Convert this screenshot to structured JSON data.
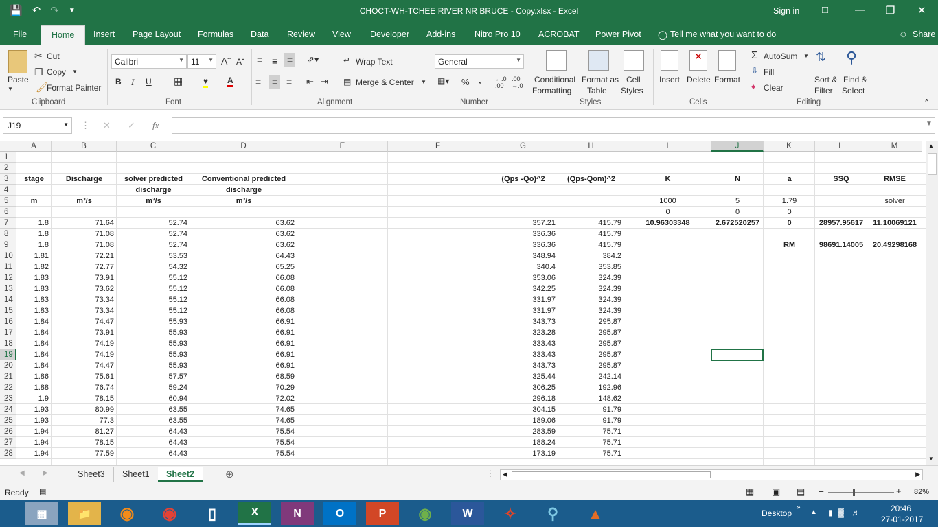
{
  "title": "CHOCT-WH-TCHEE RIVER NR BRUCE - Copy.xlsx  -  Excel",
  "signin": "Sign in",
  "tabs": [
    "File",
    "Home",
    "Insert",
    "Page Layout",
    "Formulas",
    "Data",
    "Review",
    "View",
    "Developer",
    "Add-ins",
    "Nitro Pro 10",
    "ACROBAT",
    "Power Pivot"
  ],
  "tell_me": "Tell me what you want to do",
  "share": "Share",
  "ribbon": {
    "paste": "Paste",
    "cut": "Cut",
    "copy": "Copy",
    "format_painter": "Format Painter",
    "clipboard": "Clipboard",
    "font_name": "Calibri",
    "font_size": "11",
    "font_group": "Font",
    "wrap_text": "Wrap Text",
    "merge_center": "Merge & Center",
    "alignment": "Alignment",
    "number_format": "General",
    "number": "Number",
    "percent": "%",
    "comma": ",",
    "conditional": "Conditional",
    "formatting": "Formatting",
    "format_as": "Format as",
    "table": "Table",
    "cell": "Cell",
    "cell_styles": "Styles",
    "styles": "Styles",
    "insert": "Insert",
    "delete": "Delete",
    "format": "Format",
    "cells": "Cells",
    "autosum": "AutoSum",
    "fill": "Fill",
    "clear": "Clear",
    "sort": "Sort &",
    "filter": "Filter",
    "find": "Find &",
    "select": "Select",
    "editing": "Editing"
  },
  "namebox": "J19",
  "fx": "fx",
  "columns": [
    "A",
    "B",
    "C",
    "D",
    "E",
    "F",
    "G",
    "H",
    "I",
    "J",
    "K",
    "L",
    "M"
  ],
  "rows": [
    "1",
    "2",
    "3",
    "4",
    "5",
    "6",
    "7",
    "8",
    "9",
    "10",
    "11",
    "12",
    "13",
    "14",
    "15",
    "16",
    "17",
    "18",
    "19",
    "20",
    "21",
    "22",
    "23",
    "24",
    "25",
    "26",
    "27",
    "28"
  ],
  "cells": {
    "A3": "stage",
    "B3": "Discharge",
    "C3": "solver predicted",
    "D3": "Conventional predicted",
    "G3": "(Qps -Qo)^2",
    "H3": "(Qps-Qom)^2",
    "I3": "K",
    "J3": "N",
    "K3": "a",
    "L3": "SSQ",
    "M3": "RMSE",
    "C4": "discharge",
    "D4": "discharge",
    "A5": "m",
    "B5": "m³/s",
    "C5": "m³/s",
    "D5": "m³/s",
    "I5": "1000",
    "J5": "5",
    "K5": "1.79",
    "M5": "solver",
    "I6": "0",
    "J6": "0",
    "K6": "0",
    "I7": "10.96303348",
    "J7": "2.672520257",
    "K7": "0",
    "L7": "28957.95617",
    "M7": "11.10069121",
    "K9": "RM",
    "L9": "98691.14005",
    "M9": "20.49298168"
  },
  "table": [
    [
      "1.8",
      "71.64",
      "52.74",
      "63.62",
      "357.21",
      "415.79"
    ],
    [
      "1.8",
      "71.08",
      "52.74",
      "63.62",
      "336.36",
      "415.79"
    ],
    [
      "1.8",
      "71.08",
      "52.74",
      "63.62",
      "336.36",
      "415.79"
    ],
    [
      "1.81",
      "72.21",
      "53.53",
      "64.43",
      "348.94",
      "384.2"
    ],
    [
      "1.82",
      "72.77",
      "54.32",
      "65.25",
      "340.4",
      "353.85"
    ],
    [
      "1.83",
      "73.91",
      "55.12",
      "66.08",
      "353.06",
      "324.39"
    ],
    [
      "1.83",
      "73.62",
      "55.12",
      "66.08",
      "342.25",
      "324.39"
    ],
    [
      "1.83",
      "73.34",
      "55.12",
      "66.08",
      "331.97",
      "324.39"
    ],
    [
      "1.83",
      "73.34",
      "55.12",
      "66.08",
      "331.97",
      "324.39"
    ],
    [
      "1.84",
      "74.47",
      "55.93",
      "66.91",
      "343.73",
      "295.87"
    ],
    [
      "1.84",
      "73.91",
      "55.93",
      "66.91",
      "323.28",
      "295.87"
    ],
    [
      "1.84",
      "74.19",
      "55.93",
      "66.91",
      "333.43",
      "295.87"
    ],
    [
      "1.84",
      "74.19",
      "55.93",
      "66.91",
      "333.43",
      "295.87"
    ],
    [
      "1.84",
      "74.47",
      "55.93",
      "66.91",
      "343.73",
      "295.87"
    ],
    [
      "1.86",
      "75.61",
      "57.57",
      "68.59",
      "325.44",
      "242.14"
    ],
    [
      "1.88",
      "76.74",
      "59.24",
      "70.29",
      "306.25",
      "192.96"
    ],
    [
      "1.9",
      "78.15",
      "60.94",
      "72.02",
      "296.18",
      "148.62"
    ],
    [
      "1.93",
      "80.99",
      "63.55",
      "74.65",
      "304.15",
      "91.79"
    ],
    [
      "1.93",
      "77.3",
      "63.55",
      "74.65",
      "189.06",
      "91.79"
    ],
    [
      "1.94",
      "81.27",
      "64.43",
      "75.54",
      "283.59",
      "75.71"
    ],
    [
      "1.94",
      "78.15",
      "64.43",
      "75.54",
      "188.24",
      "75.71"
    ],
    [
      "1.94",
      "77.59",
      "64.43",
      "75.54",
      "173.19",
      "75.71"
    ]
  ],
  "sheets": [
    "Sheet3",
    "Sheet1",
    "Sheet2"
  ],
  "active_sheet": "Sheet2",
  "status": "Ready",
  "zoom": "82%",
  "taskbar": {
    "desktop": "Desktop",
    "time": "20:46",
    "date": "27-01-2017"
  }
}
